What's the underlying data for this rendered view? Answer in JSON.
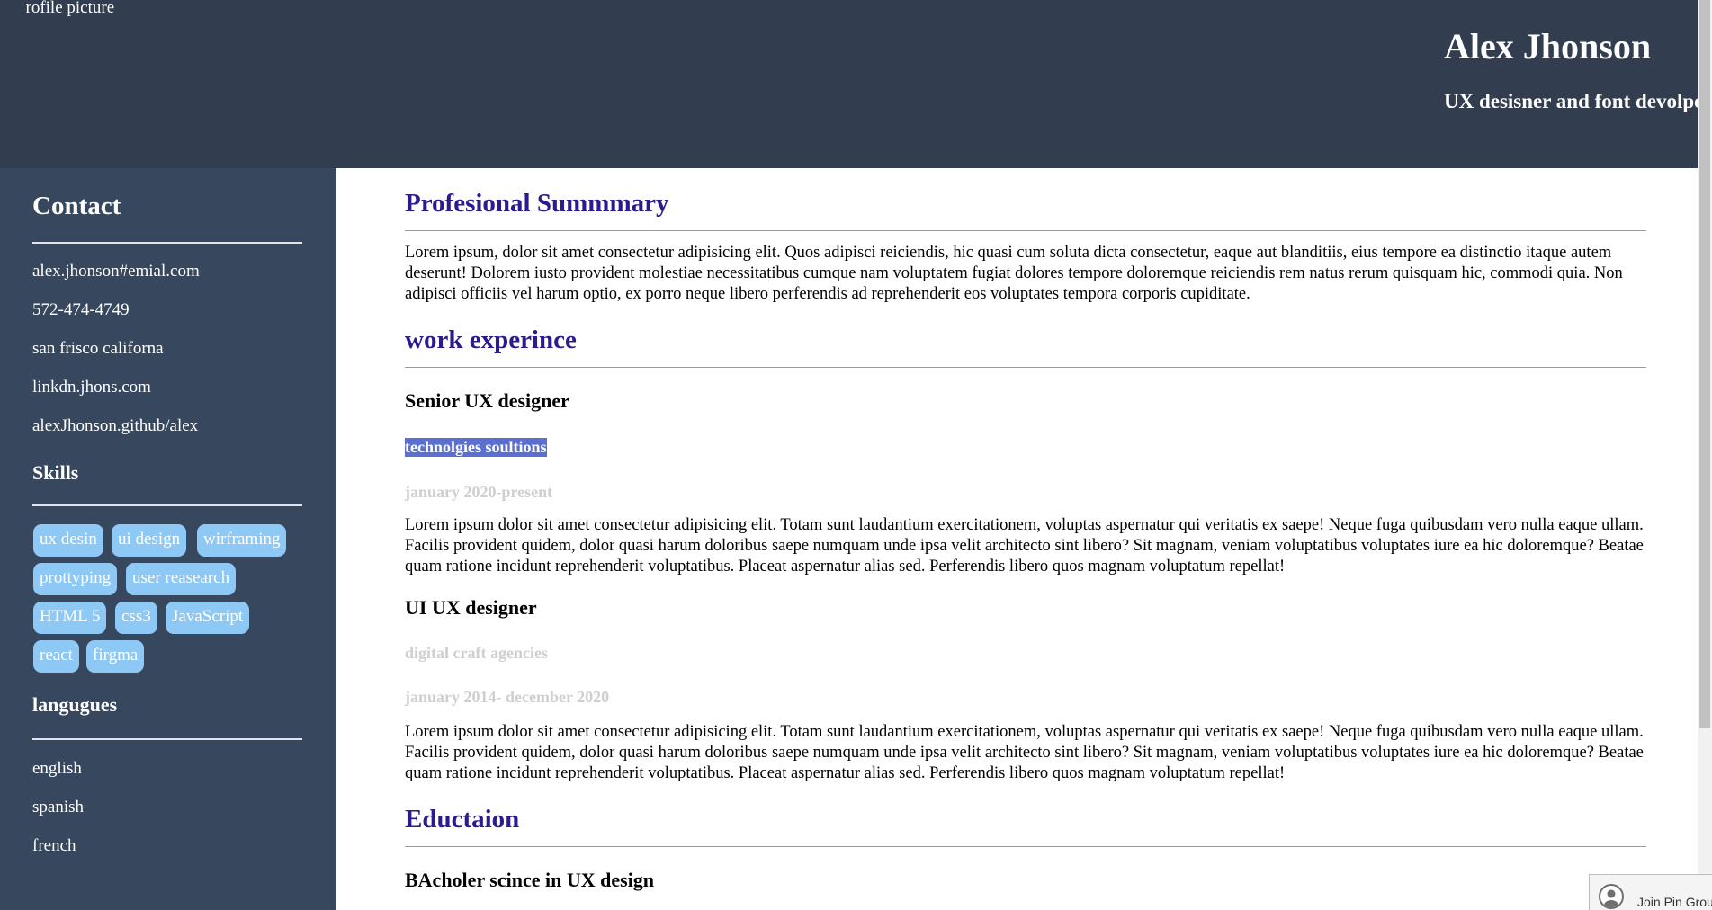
{
  "header": {
    "profile_alt": "profile picture",
    "name": "Alex Jhonson",
    "role": "UX desisner and font devolper"
  },
  "sidebar": {
    "contact_heading": "Contact",
    "contacts": [
      "alex.jhonson#emial.com",
      "572-474-4749",
      "san frisco californa",
      "linkdn.jhons.com",
      "alexJhonson.github/alex"
    ],
    "skills_heading": "Skills",
    "skills": [
      "ux desin",
      "ui design",
      "wirframing",
      "prottyping",
      "user reasearch",
      "HTML 5",
      "css3",
      "JavaScript",
      "react",
      "firgma"
    ],
    "languages_heading": "langugues",
    "languages": [
      "english",
      "spanish",
      "french"
    ]
  },
  "main": {
    "summary_title": "Profesional Summmary",
    "summary_text": "Lorem ipsum, dolor sit amet consectetur adipisicing elit. Quos adipisci reiciendis, hic quasi cum soluta dicta consectetur, eaque aut blanditiis, eius tempore ea distinctio itaque autem deserunt! Dolorem iusto provident molestiae necessitatibus cumque nam voluptatem fugiat dolores tempore doloremque reiciendis rem natus rerum quisquam hic, commodi quia. Non adipisci officiis vel harum optio, ex porro neque libero perferendis ad reprehenderit eos voluptates tempora corporis cupiditate.",
    "experience_title": "work experince",
    "jobs": [
      {
        "title": "Senior UX designer",
        "company": "technolgies soultions",
        "dates": "january 2020-present",
        "description": "Lorem ipsum dolor sit amet consectetur adipisicing elit. Totam sunt laudantium exercitationem, voluptas aspernatur qui veritatis ex saepe! Neque fuga quibusdam vero nulla eaque ullam. Facilis provident quidem, dolor quasi harum doloribus saepe numquam unde ipsa velit architecto sint libero? Sit magnam, veniam voluptatibus voluptates iure ea hic doloremque? Beatae quam ratione incidunt reprehenderit voluptatibus. Placeat aspernatur alias sed. Perferendis libero quos magnam voluptatum repellat!"
      },
      {
        "title": "UI UX designer",
        "company": "digital craft agencies",
        "dates": "january 2014- december 2020",
        "description": "Lorem ipsum dolor sit amet consectetur adipisicing elit. Totam sunt laudantium exercitationem, voluptas aspernatur qui veritatis ex saepe! Neque fuga quibusdam vero nulla eaque ullam. Facilis provident quidem, dolor quasi harum doloribus saepe numquam unde ipsa velit architecto sint libero? Sit magnam, veniam voluptatibus voluptates iure ea hic doloremque? Beatae quam ratione incidunt reprehenderit voluptatibus. Placeat aspernatur alias sed. Perferendis libero quos magnam voluptatum repellat!"
      }
    ],
    "education_title": "Eductaion",
    "education_degree": "BAcholer scince in UX design"
  },
  "popup": {
    "label": "Join Pin Group"
  },
  "colors": {
    "header_bg": "#323e4f",
    "sidebar_bg": "#37475d",
    "section_title": "#2a1c8e",
    "skill_tag": "#8ec8f5",
    "selection": "#5b6fd1"
  }
}
